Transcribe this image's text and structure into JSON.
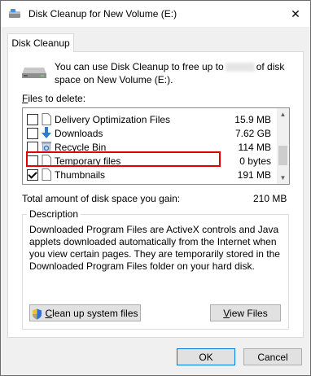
{
  "window": {
    "title": "Disk Cleanup for New Volume (E:)",
    "close_glyph": "✕"
  },
  "tab": {
    "label": "Disk Cleanup"
  },
  "intro": {
    "before": "You can use Disk Cleanup to free up to",
    "after": "of disk space on New Volume (E:)."
  },
  "files_label": {
    "underlined": "F",
    "rest": "iles to delete:"
  },
  "files": [
    {
      "name": "Delivery Optimization Files",
      "size": "15.9 MB",
      "checked": false,
      "icon": "blank-file-icon"
    },
    {
      "name": "Downloads",
      "size": "7.62 GB",
      "checked": false,
      "icon": "download-arrow-icon"
    },
    {
      "name": "Recycle Bin",
      "size": "114 MB",
      "checked": false,
      "icon": "recycle-bin-icon"
    },
    {
      "name": "Temporary files",
      "size": "0 bytes",
      "checked": false,
      "icon": "blank-file-icon"
    },
    {
      "name": "Thumbnails",
      "size": "191 MB",
      "checked": true,
      "icon": "blank-file-icon"
    }
  ],
  "total": {
    "label": "Total amount of disk space you gain:",
    "value": "210 MB"
  },
  "description": {
    "legend": "Description",
    "text": "Downloaded Program Files are ActiveX controls and Java applets downloaded automatically from the Internet when you view certain pages. They are temporarily stored in the Downloaded Program Files folder on your hard disk."
  },
  "buttons": {
    "cleanup_system": {
      "underlined": "C",
      "rest": "lean up system files"
    },
    "view_files": {
      "underlined": "V",
      "rest": "iew Files"
    },
    "ok": "OK",
    "cancel": "Cancel"
  },
  "colors": {
    "highlight": "#e00000",
    "accent": "#0078d7"
  }
}
